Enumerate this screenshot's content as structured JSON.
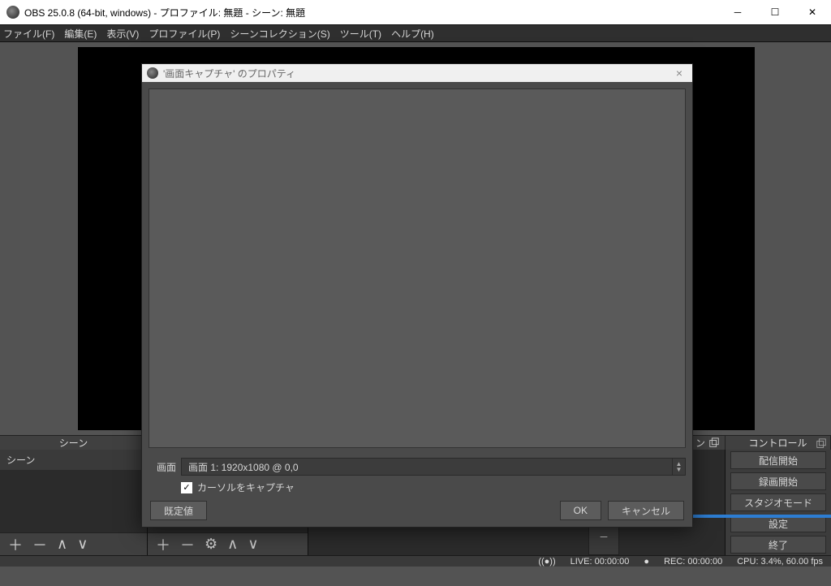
{
  "window": {
    "title": "OBS 25.0.8 (64-bit, windows) - プロファイル: 無題 - シーン: 無題"
  },
  "menu": {
    "file": "ファイル(F)",
    "edit": "編集(E)",
    "view": "表示(V)",
    "profile": "プロファイル(P)",
    "scenecollection": "シーンコレクション(S)",
    "tools": "ツール(T)",
    "help": "ヘルプ(H)"
  },
  "panels": {
    "scenes_title": "シーン",
    "transitions_title_tail": "ン",
    "controls_title": "コントロール",
    "scene_item": "シーン"
  },
  "controls": {
    "start_stream": "配信開始",
    "start_record": "録画開始",
    "studio_mode": "スタジオモード",
    "settings": "設定",
    "exit": "終了"
  },
  "status": {
    "live": "LIVE: 00:00:00",
    "rec": "REC: 00:00:00",
    "cpu": "CPU: 3.4%, 60.00 fps"
  },
  "dialog": {
    "title": "'画面キャプチャ' のプロパティ",
    "screen_label": "画面",
    "screen_value": "画面 1: 1920x1080 @ 0,0",
    "cursor_checkbox": "カーソルをキャプチャ",
    "defaults_btn": "既定値",
    "ok_btn": "OK",
    "cancel_btn": "キャンセル"
  }
}
